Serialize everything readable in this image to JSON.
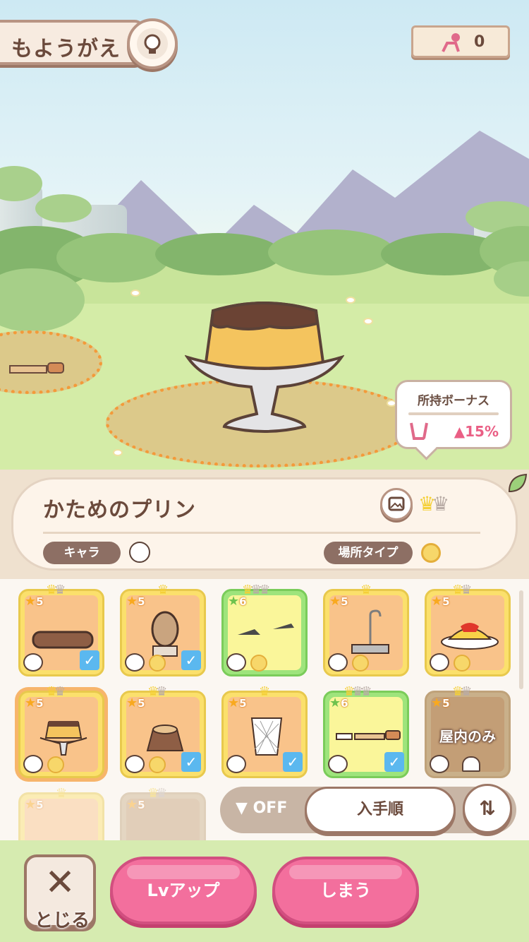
{
  "header": {
    "title": "もようがえ",
    "currency_value": "0"
  },
  "bonus": {
    "label": "所持ボーナス",
    "value": "▲15%"
  },
  "info": {
    "item_name": "かためのプリン",
    "chara_label": "キャラ",
    "place_label": "場所タイプ"
  },
  "grid": {
    "items": [
      {
        "stars": "5",
        "name": "log",
        "checked": true,
        "crowns": [
          "gold",
          "gray"
        ]
      },
      {
        "stars": "5",
        "name": "statue",
        "checked": true,
        "crowns": [
          "gold"
        ]
      },
      {
        "stars": "6",
        "name": "seaweed",
        "checked": false,
        "crowns": [
          "gold",
          "gray",
          "gray"
        ]
      },
      {
        "stars": "5",
        "name": "faucet",
        "checked": false,
        "crowns": [
          "gold"
        ]
      },
      {
        "stars": "5",
        "name": "omurice",
        "checked": false,
        "crowns": [
          "gold",
          "gray"
        ]
      },
      {
        "stars": "5",
        "name": "pudding",
        "checked": false,
        "crowns": [
          "gold",
          "gray"
        ]
      },
      {
        "stars": "5",
        "name": "stump",
        "checked": true,
        "crowns": [
          "gold",
          "gray"
        ]
      },
      {
        "stars": "5",
        "name": "trash-can",
        "checked": true,
        "crowns": [
          "gold"
        ]
      },
      {
        "stars": "6",
        "name": "picnic-table",
        "checked": true,
        "crowns": [
          "gold",
          "gray",
          "gray"
        ]
      },
      {
        "stars": "5",
        "name": "indoor",
        "checked": false,
        "crowns": [
          "gold",
          "gray"
        ]
      },
      {
        "stars": "5",
        "name": "partial-1",
        "checked": false,
        "crowns": [
          "gold"
        ]
      },
      {
        "stars": "5",
        "name": "partial-2",
        "checked": false,
        "crowns": [
          "gold",
          "gray"
        ]
      }
    ],
    "indoor_label": "屋内のみ"
  },
  "filter": {
    "filter_label": "OFF",
    "sort_label": "入手順"
  },
  "actions": {
    "close_label": "とじる",
    "lvup_label": "Lvアップ",
    "store_label": "しまう"
  },
  "colors": {
    "accent_pink": "#f36f9d",
    "bonus_red": "#ea5f85",
    "check_blue": "#5bb8ef"
  }
}
